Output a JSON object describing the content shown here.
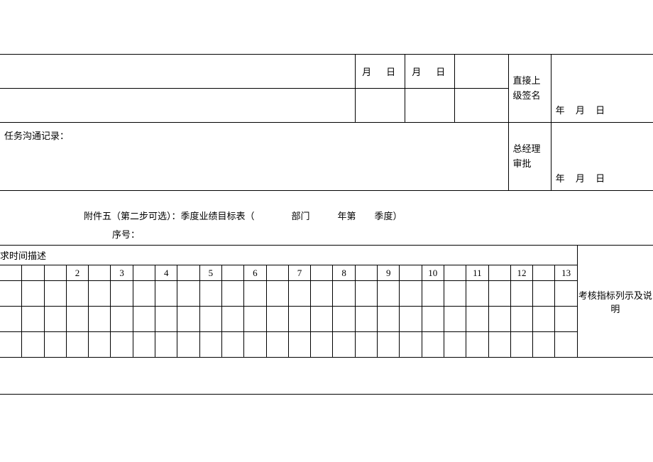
{
  "top": {
    "date1": "月　日",
    "date2": "月　日",
    "supervisorLabel": "直接上级签名",
    "dateTemplate1": "年 月 日",
    "recordLabel": "任务沟通记录：",
    "gmLabel": "总经理审批",
    "dateTemplate2": "年 月 日"
  },
  "middle": {
    "caption1": "附件五（第二步可选）：季度业绩目标表（　　　　部门　　　年第　　季度）",
    "caption2": "序号："
  },
  "bottom": {
    "timeHeader": "求时间描述",
    "indicatorHeader": "考核指标列示及说明",
    "numbers": [
      "2",
      "3",
      "4",
      "5",
      "6",
      "7",
      "8",
      "9",
      "10",
      "11",
      "12",
      "13"
    ]
  }
}
